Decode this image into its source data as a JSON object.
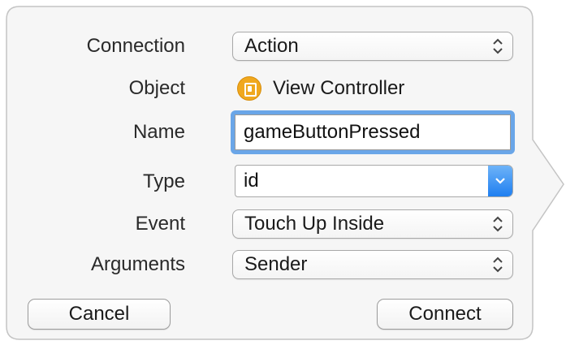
{
  "connection": {
    "label": "Connection",
    "value": "Action"
  },
  "object": {
    "label": "Object",
    "value": "View Controller",
    "icon": "view-controller-icon",
    "icon_color": "#f0a81e"
  },
  "name": {
    "label": "Name",
    "value": "gameButtonPressed"
  },
  "type": {
    "label": "Type",
    "value": "id"
  },
  "event": {
    "label": "Event",
    "value": "Touch Up Inside"
  },
  "arguments": {
    "label": "Arguments",
    "value": "Sender"
  },
  "buttons": {
    "cancel": "Cancel",
    "connect": "Connect"
  },
  "colors": {
    "focus_ring": "#6aa6e8",
    "combo_button": "#1f7ff0",
    "background": "#f6f6f6"
  }
}
